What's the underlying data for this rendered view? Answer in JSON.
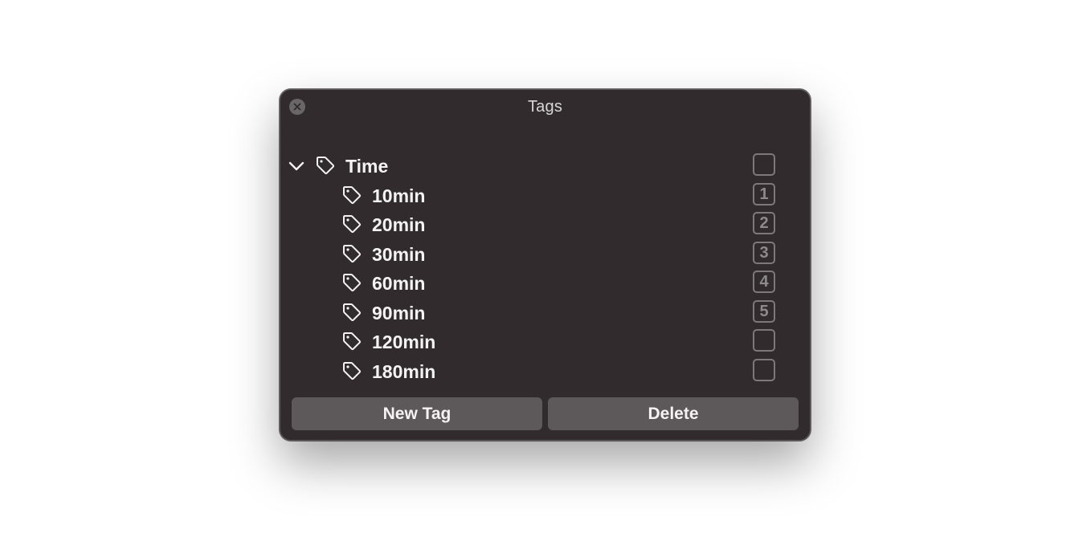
{
  "window": {
    "title": "Tags"
  },
  "tags": {
    "parent": {
      "label": "Time",
      "expanded": true,
      "shortcut": ""
    },
    "children": [
      {
        "label": "10min",
        "shortcut": "1"
      },
      {
        "label": "20min",
        "shortcut": "2"
      },
      {
        "label": "30min",
        "shortcut": "3"
      },
      {
        "label": "60min",
        "shortcut": "4"
      },
      {
        "label": "90min",
        "shortcut": "5"
      },
      {
        "label": "120min",
        "shortcut": ""
      },
      {
        "label": "180min",
        "shortcut": ""
      }
    ]
  },
  "buttons": {
    "new_tag": "New Tag",
    "delete": "Delete"
  },
  "icons": {
    "close": "close-icon",
    "chevron": "chevron-down-icon",
    "tag": "tag-icon"
  },
  "colors": {
    "window_bg": "#312b2d",
    "button_bg": "#5d5859",
    "text": "#f4f2f3",
    "shortcut_border": "#7d787a"
  }
}
